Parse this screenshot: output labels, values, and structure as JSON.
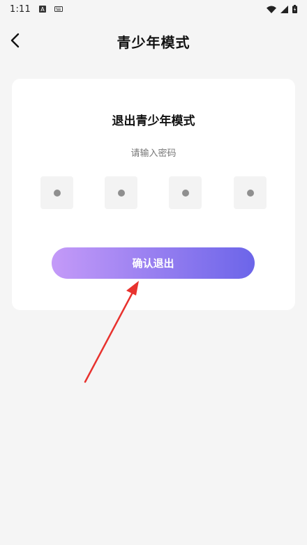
{
  "status_bar": {
    "time": "1:11",
    "icons": [
      "a-icon",
      "keyboard-icon",
      "wifi-icon",
      "signal-icon",
      "battery-icon"
    ]
  },
  "nav": {
    "title": "青少年模式",
    "back_icon": "chevron-left-icon"
  },
  "card": {
    "title": "退出青少年模式",
    "subtitle": "请输入密码",
    "pin": {
      "length": 4,
      "filled": 4
    },
    "confirm_label": "确认退出"
  },
  "colors": {
    "background": "#f5f5f5",
    "card": "#ffffff",
    "button_gradient_start": "#c49af8",
    "button_gradient_end": "#6c65e9",
    "pin_box": "#f3f3f3",
    "pin_dot": "#8f8f8f",
    "annotation_arrow": "#e8322e"
  }
}
